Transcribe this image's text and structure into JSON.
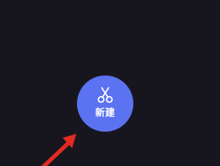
{
  "screen": {
    "background": "#17161f"
  },
  "fab": {
    "label": "新建",
    "icon": "scissors-icon",
    "color": "#5b73f0"
  },
  "annotation": {
    "arrow_icon": "red-arrow-icon",
    "arrow_color": "#e02a22"
  }
}
